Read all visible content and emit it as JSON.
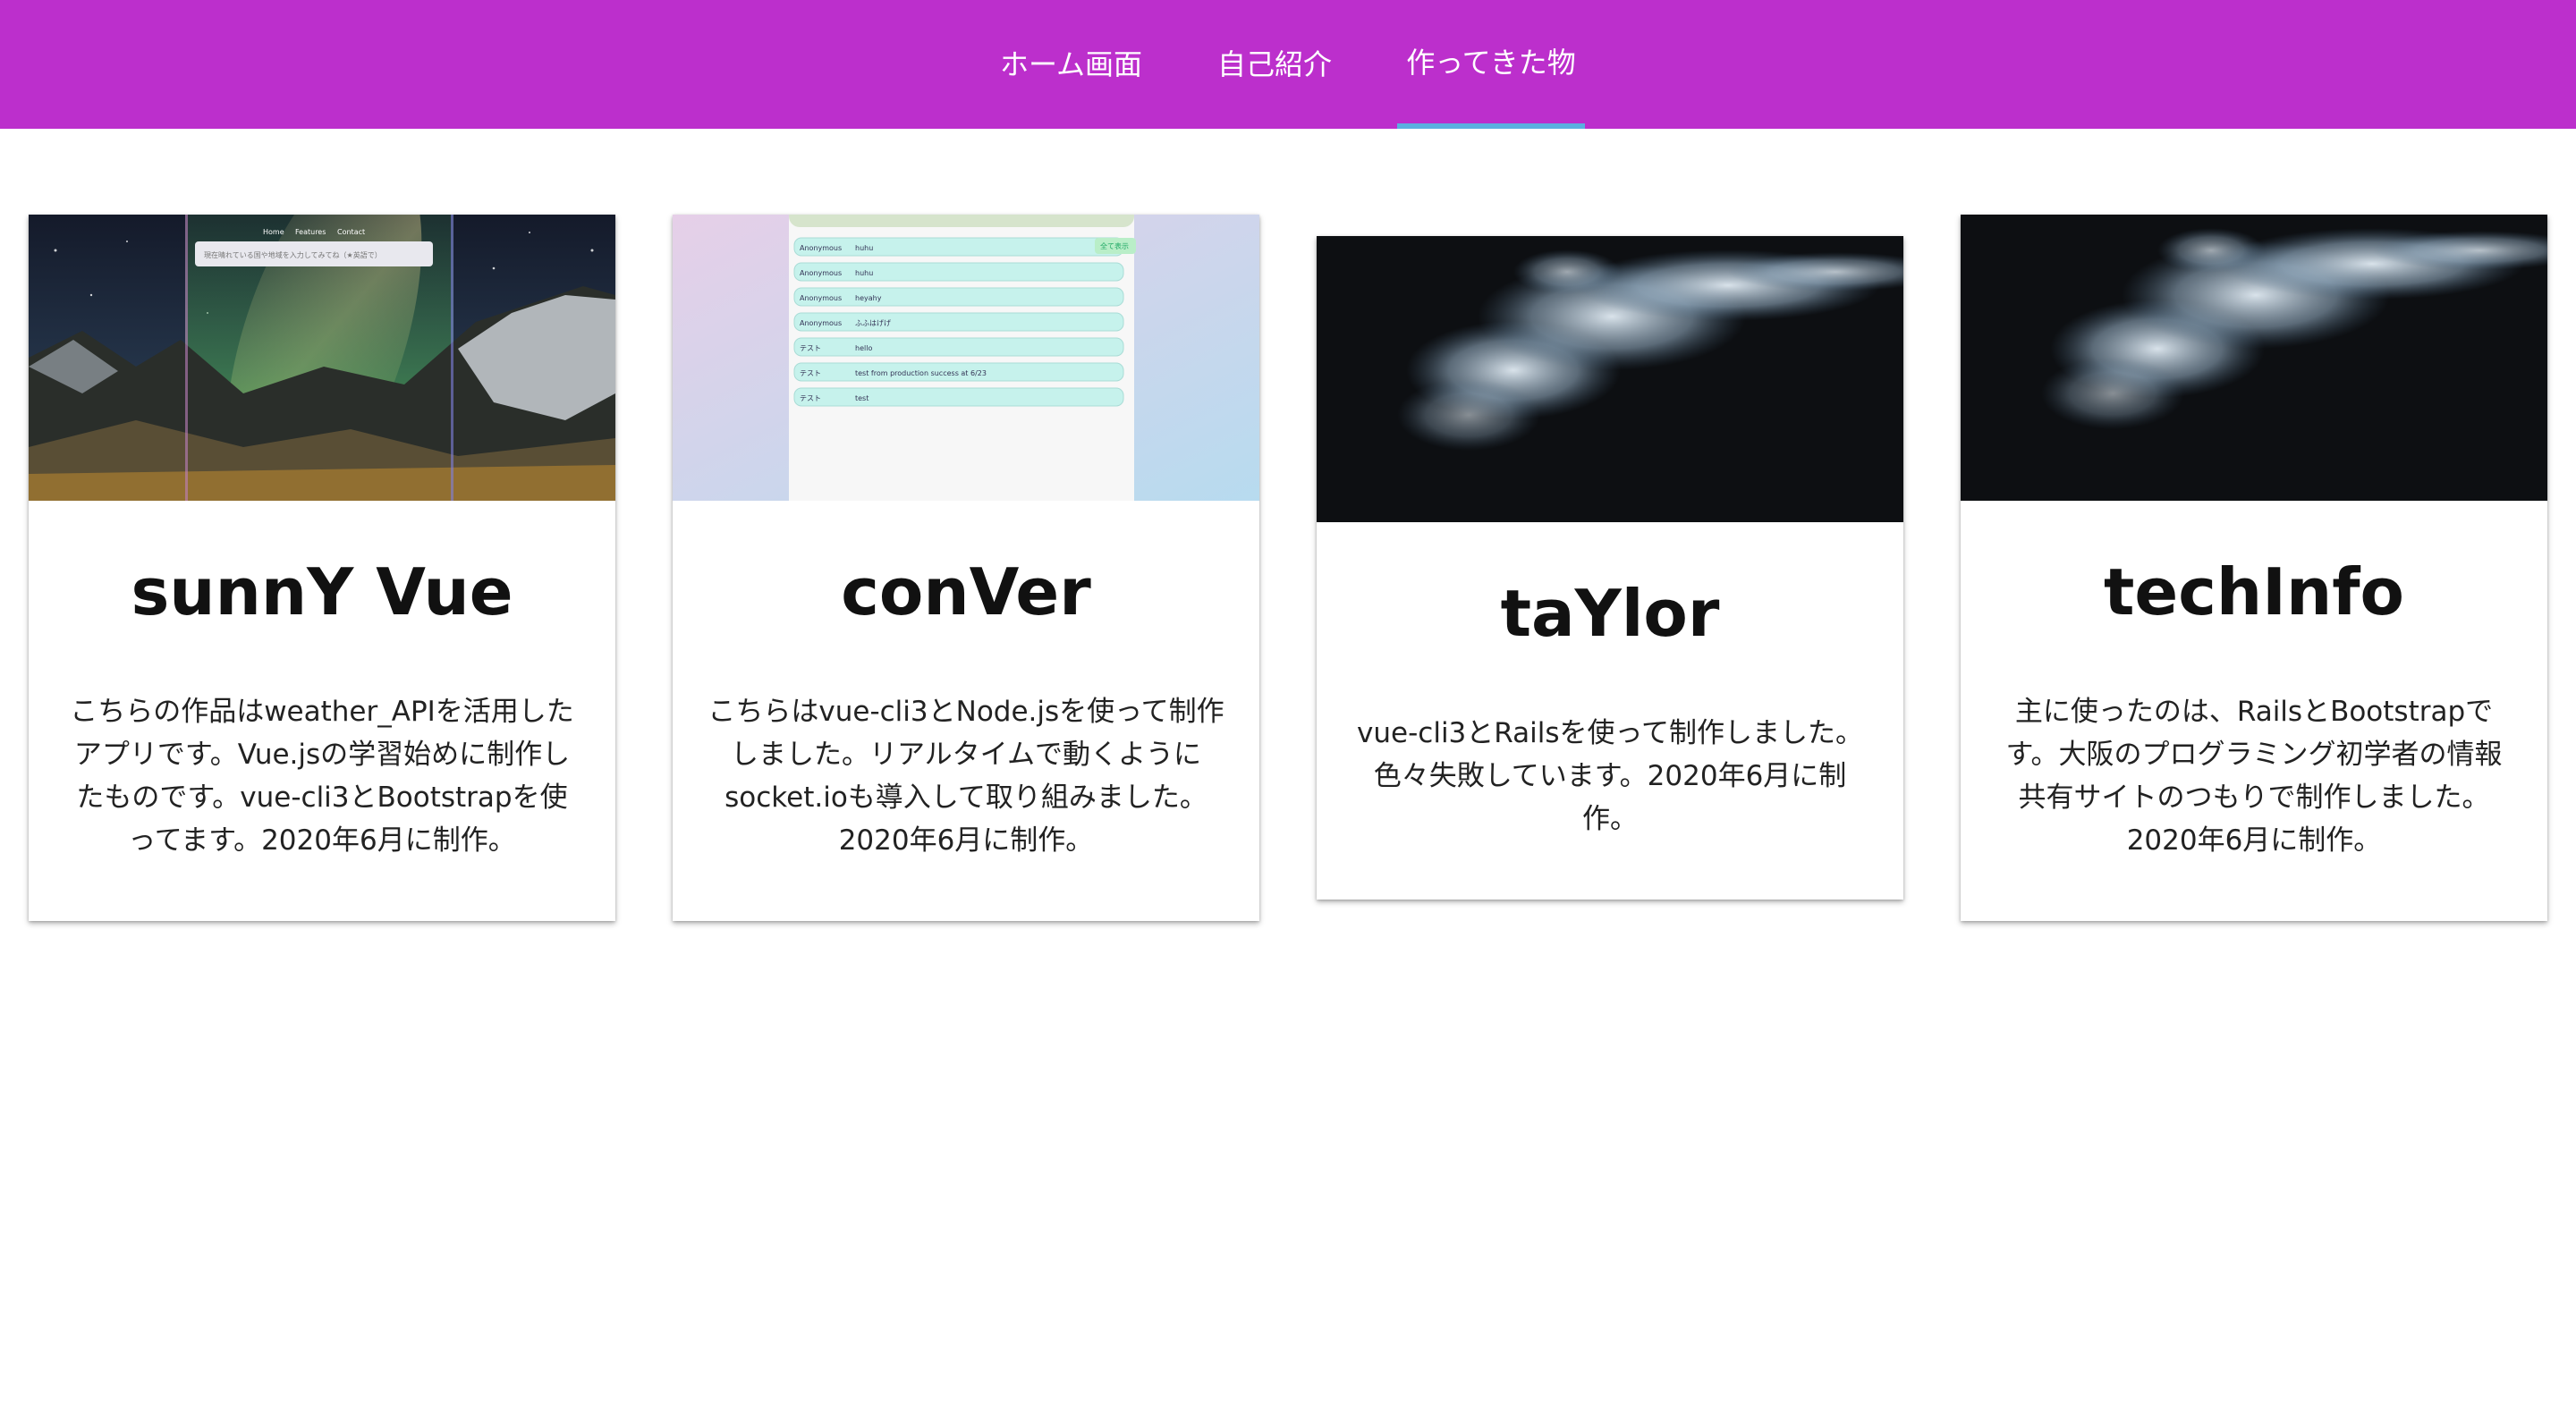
{
  "nav": {
    "tabs": [
      {
        "label": "ホーム画面"
      },
      {
        "label": "自己紹介"
      },
      {
        "label": "作ってきた物"
      }
    ],
    "active_tab": "作ってきた物",
    "bar_color": "#bc2fcc",
    "underline_color": "#5ab0e0"
  },
  "works": [
    {
      "title": "sunnY Vue",
      "description": "こちらの作品はweather_APIを活用したアプリです。Vue.jsの学習始めに制作したものです。vue-cli3とBootstrapを使ってます。2020年6月に制作。",
      "image": "night-sky-mountain-screenshot",
      "screenshot": {
        "nav_links": [
          "Home",
          "Features",
          "Contact"
        ],
        "search_placeholder": "現在晴れている国や地域を入力してみてね（★英語で）"
      }
    },
    {
      "title": "conVer",
      "description": "こちらはvue-cli3とNode.jsを使って制作しました。リアルタイムで動くようにsocket.ioも導入して取り組みました。2020年6月に制作。",
      "image": "chat-app-screenshot",
      "screenshot": {
        "button_label": "全て表示",
        "messages": [
          {
            "user": "Anonymous",
            "text": "huhu"
          },
          {
            "user": "Anonymous",
            "text": "huhu"
          },
          {
            "user": "Anonymous",
            "text": "heyahy"
          },
          {
            "user": "Anonymous",
            "text": "ふふはげげ"
          },
          {
            "user": "テスト",
            "text": "hello"
          },
          {
            "user": "テスト",
            "text": "test from production success at 6/23"
          },
          {
            "user": "テスト",
            "text": "test"
          }
        ]
      }
    },
    {
      "title": "taYlor",
      "description": "vue-cli3とRailsを使って制作しました。色々失敗しています。2020年6月に制作。",
      "image": "smoke-cloud-image"
    },
    {
      "title": "techInfo",
      "description": "主に使ったのは、RailsとBootstrapです。大阪のプログラミング初学者の情報共有サイトのつもりで制作しました。2020年6月に制作。",
      "image": "smoke-cloud-image"
    }
  ]
}
